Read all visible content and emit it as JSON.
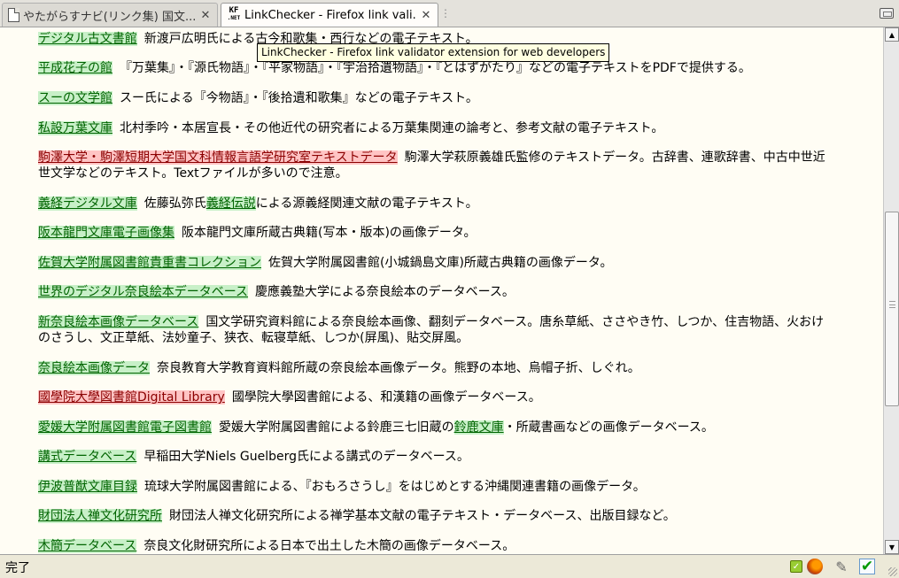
{
  "tabs": [
    {
      "title": "やたがらすナビ(リンク集)  国文...",
      "icon": "document-icon",
      "active": false
    },
    {
      "title": "LinkChecker - Firefox link vali...",
      "icon": "kf-icon",
      "active": true
    }
  ],
  "tab_close_symbol": "✕",
  "tab_kf_icon_text": "KF",
  "tab_kf_icon_sub": ".NET",
  "tooltip": "LinkChecker - Firefox link validator extension for web developers",
  "entries": [
    {
      "link": "デジタル古文書館",
      "status": "ok",
      "desc": "新渡戸広明氏による古今和歌集・西行などの電子テキスト。"
    },
    {
      "link": "平成花子の館",
      "status": "ok",
      "desc": "『万葉集』・『源氏物語』・『平家物語』・『宇治拾遺物語』・『とはずがたり』などの電子テキストをPDFで提供する。"
    },
    {
      "link": "スーの文学館",
      "status": "ok",
      "desc": "スー氏による『今物語』・『後拾遺和歌集』などの電子テキスト。"
    },
    {
      "link": "私設万葉文庫",
      "status": "ok",
      "desc": "北村季吟・本居宣長・その他近代の研究者による万葉集関連の論考と、参考文献の電子テキスト。"
    },
    {
      "link": "駒澤大学・駒澤短期大学国文科情報言語学研究室テキストデータ",
      "status": "bad",
      "desc": "駒澤大学萩原義雄氏監修のテキストデータ。古辞書、連歌辞書、中古中世近世文学などのテキスト。Textファイルが多いので注意。"
    },
    {
      "link": "義経デジタル文庫",
      "status": "ok",
      "desc_before": "佐藤弘弥氏",
      "inner_link": "義経伝説",
      "desc_after": "による源義経関連文献の電子テキスト。"
    },
    {
      "link": "阪本龍門文庫電子画像集",
      "status": "ok",
      "desc": "阪本龍門文庫所蔵古典籍(写本・版本)の画像データ。"
    },
    {
      "link": "佐賀大学附属図書館貴重書コレクション",
      "status": "ok",
      "desc": "佐賀大学附属図書館(小城鍋島文庫)所蔵古典籍の画像データ。"
    },
    {
      "link": "世界のデジタル奈良絵本データベース",
      "status": "ok",
      "desc": "慶應義塾大学による奈良絵本のデータベース。"
    },
    {
      "link": "新奈良絵本画像データベース",
      "status": "ok",
      "desc": "国文学研究資料館による奈良絵本画像、翻刻データベース。唐糸草紙、ささやき竹、しつか、住吉物語、火おけのさうし、文正草紙、法妙童子、狭衣、転寝草紙、しつか(屏風)、貼交屏風。"
    },
    {
      "link": "奈良絵本画像データ",
      "status": "ok",
      "desc": "奈良教育大学教育資料館所蔵の奈良絵本画像データ。熊野の本地、烏帽子折、しぐれ。"
    },
    {
      "link": "國學院大學図書館Digital Library",
      "status": "bad",
      "desc": "國學院大學図書館による、和漢籍の画像データベース。"
    },
    {
      "link": "愛媛大学附属図書館電子図書館",
      "status": "ok",
      "desc_before": "愛媛大学附属図書館による鈴鹿三七旧蔵の",
      "inner_link": "鈴鹿文庫",
      "desc_after": "・所蔵書画などの画像データベース。"
    },
    {
      "link": "講式データベース",
      "status": "ok",
      "desc": "早稲田大学Niels Guelberg氏による講式のデータベース。"
    },
    {
      "link": "伊波普猷文庫目録",
      "status": "ok",
      "desc": "琉球大学附属図書館による、『おもろさうし』をはじめとする沖縄関連書籍の画像データ。"
    },
    {
      "link": "財団法人禅文化研究所",
      "status": "ok",
      "desc": "財団法人禅文化研究所による禅学基本文献の電子テキスト・データベース、出版目録など。"
    },
    {
      "link": "木簡データベース",
      "status": "ok",
      "desc": "奈良文化財研究所による日本で出土した木簡の画像データベース。"
    }
  ],
  "scrollbar": {
    "up_arrow": "▲",
    "down_arrow": "▼",
    "position_fraction": 0.56
  },
  "status": {
    "text": "完了",
    "pen_glyph": "✎",
    "check_glyph": "✔"
  },
  "colors": {
    "ok_bg": "#c8f0c8",
    "bad_bg": "#ffc4c4"
  }
}
